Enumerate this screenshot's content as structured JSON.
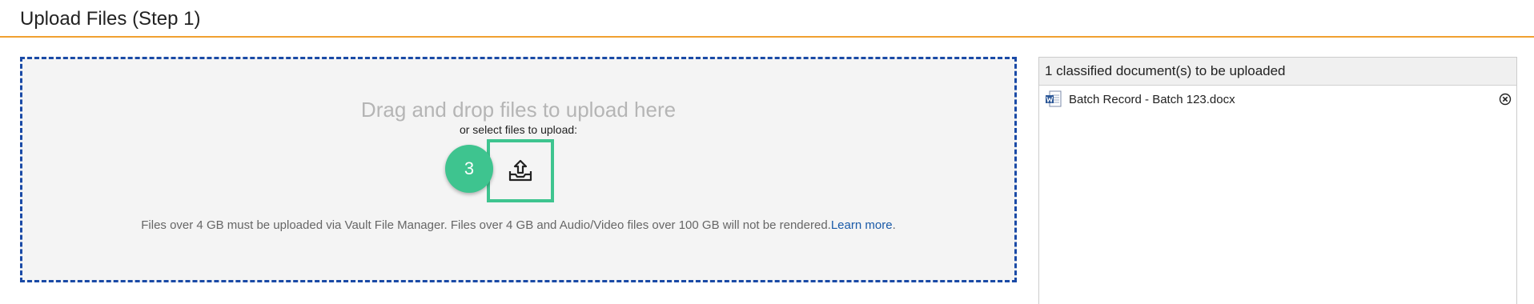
{
  "header": {
    "title": "Upload Files (Step 1)",
    "accent_color": "#f0a030"
  },
  "dropzone": {
    "heading": "Drag and drop files to upload here",
    "subheading": "or select files to upload:",
    "step_number": "3",
    "upload_icon": "upload-tray-icon",
    "note": "Files over 4 GB must be uploaded via Vault File Manager. Files over 4 GB and Audio/Video files over 100 GB will not be rendered.",
    "learn_more": "Learn more",
    "note_end": ".",
    "border_color": "#1a4aa6",
    "highlight_color": "#3ec48f"
  },
  "panel": {
    "title": "1 classified document(s) to be uploaded",
    "files": [
      {
        "name": "Batch Record - Batch 123.docx",
        "icon": "word-document-icon"
      }
    ],
    "remove_icon": "close-circle-icon"
  }
}
